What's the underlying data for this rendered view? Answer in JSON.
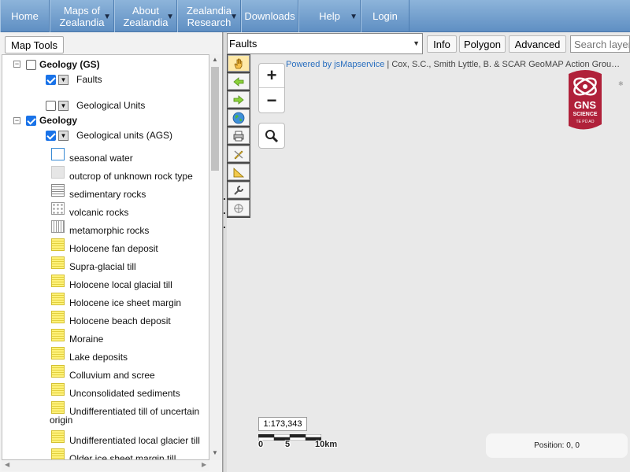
{
  "nav": {
    "home": "Home",
    "maps_line1": "Maps of",
    "maps_line2": "Zealandia",
    "about_line1": "About",
    "about_line2": "Zealandia",
    "research_line1": "Zealandia",
    "research_line2": "Research",
    "downloads": "Downloads",
    "help": "Help",
    "login": "Login",
    "dropdown_glyph": "▼"
  },
  "left_panel": {
    "map_tools_label": "Map Tools",
    "tree": [
      {
        "label": "Geology (GS)",
        "bold": true,
        "checked": false,
        "expander": "−"
      },
      {
        "label": "Faults",
        "checked": true
      },
      {
        "label": "Geological Units",
        "checked": false
      },
      {
        "label": "Geology",
        "bold": true,
        "checked": true,
        "expander": "−"
      },
      {
        "label": "Geological units (AGS)",
        "checked": true
      }
    ],
    "legend": [
      {
        "label": "seasonal water",
        "icon": "water-swatch-icon"
      },
      {
        "label": "outcrop of unknown rock type",
        "icon": "unknown-rock-swatch-icon"
      },
      {
        "label": "sedimentary rocks",
        "icon": "sedimentary-swatch-icon"
      },
      {
        "label": "volcanic rocks",
        "icon": "volcanic-swatch-icon"
      },
      {
        "label": "metamorphic rocks",
        "icon": "metamorphic-swatch-icon"
      },
      {
        "label": "Holocene fan deposit",
        "icon": "yellow-swatch-icon"
      },
      {
        "label": "Supra-glacial till",
        "icon": "yellow-swatch-icon"
      },
      {
        "label": "Holocene local glacial till",
        "icon": "yellow-swatch-icon"
      },
      {
        "label": "Holocene ice sheet margin",
        "icon": "yellow-swatch-icon"
      },
      {
        "label": "Holocene beach deposit",
        "icon": "yellow-swatch-icon"
      },
      {
        "label": "Moraine",
        "icon": "yellow-swatch-icon"
      },
      {
        "label": "Lake deposits",
        "icon": "yellow-swatch-icon"
      },
      {
        "label": "Colluvium and scree",
        "icon": "yellow-swatch-icon"
      },
      {
        "label": "Unconsolidated sediments",
        "icon": "yellow-swatch-icon"
      },
      {
        "label_line1": "Undifferentiated till of uncertain",
        "label_line2": "origin",
        "icon": "yellow-swatch-icon"
      },
      {
        "label": "Undifferentiated local glacier till",
        "icon": "yellow-swatch-icon"
      },
      {
        "label": "Older ice sheet margin till",
        "icon": "yellow-swatch-icon"
      }
    ]
  },
  "map": {
    "layer_select_value": "Faults",
    "info_label": "Info",
    "polygon_label": "Polygon",
    "advanced_label": "Advanced",
    "search_placeholder": "Search layers",
    "zoom_in": "+",
    "zoom_out": "−",
    "attribution_link": "Powered by jsMapservice",
    "attribution_text": " | Cox, S.C., Smith Lyttle, B. & SCAR GeoMAP Action Grou…",
    "logo_text_1": "GNS",
    "logo_text_2": "SCIENCE",
    "logo_text_3": "TE PŪ AO",
    "scale_ratio": "1:173,343",
    "scale_labels": [
      "0",
      "5",
      "10km"
    ],
    "position_text": "Position: 0, 0"
  },
  "colors": {
    "nav_gradient_top": "#8db4da",
    "nav_gradient_bottom": "#5f8fc3",
    "checkbox_blue": "#1a73e8",
    "legend_yellow": "#fff27a",
    "gns_red": "#b0213a"
  }
}
